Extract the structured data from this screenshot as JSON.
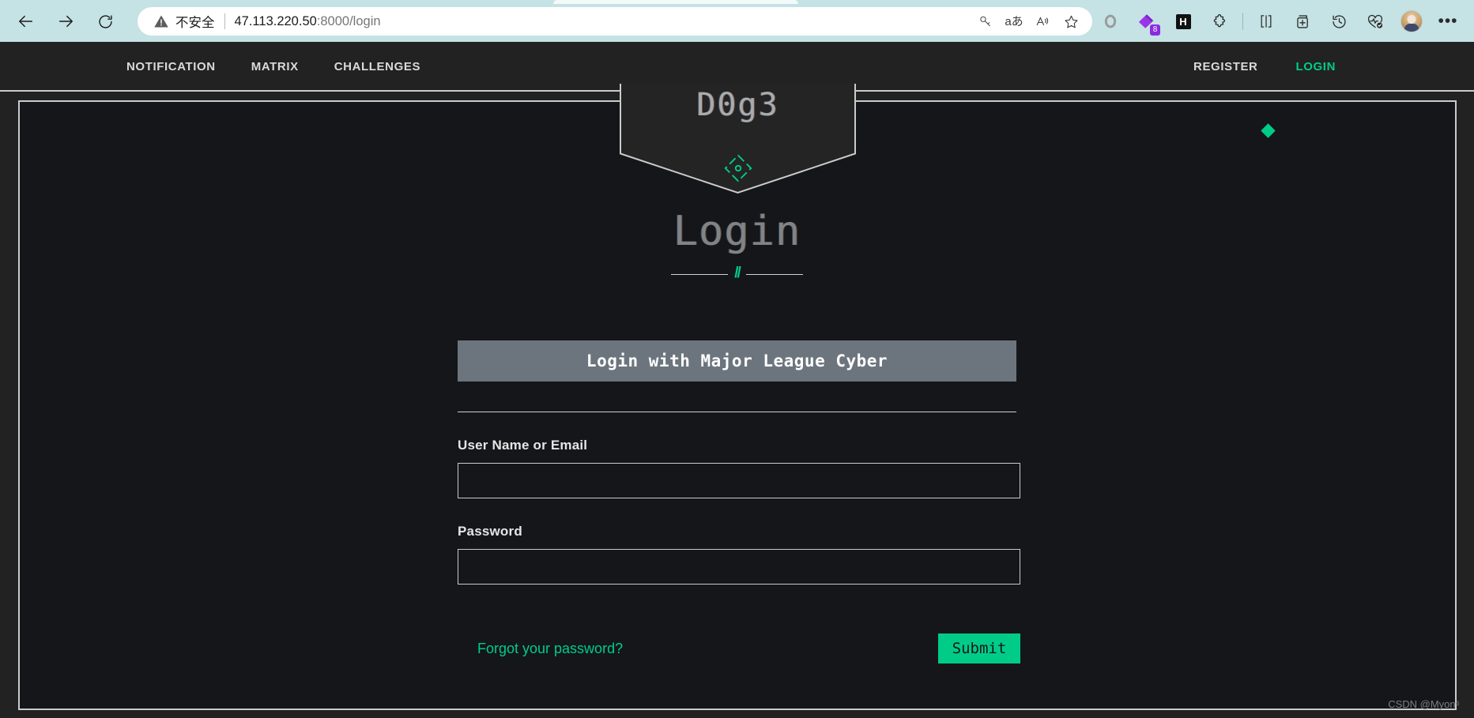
{
  "browser": {
    "back_label": "back",
    "forward_label": "forward",
    "reload_label": "reload",
    "security_text": "不安全",
    "url_host": "47.113.220.50",
    "url_rest": ":8000/login",
    "addr_icons": [
      {
        "name": "key-icon",
        "glyph": "⚷"
      },
      {
        "name": "translate-icon",
        "glyph": "aあ"
      },
      {
        "name": "read-aloud-icon",
        "glyph": "A"
      },
      {
        "name": "favorite-star-icon",
        "glyph": "☆"
      }
    ],
    "toolbar_icons": [
      {
        "name": "circle-icon",
        "label": ""
      },
      {
        "name": "extension-diamond-icon",
        "label": ""
      },
      {
        "name": "h-app-icon",
        "label": "H"
      },
      {
        "name": "extensions-puzzle-icon",
        "label": ""
      },
      {
        "name": "split-screen-icon",
        "label": ""
      },
      {
        "name": "collections-icon",
        "label": ""
      },
      {
        "name": "history-icon",
        "label": ""
      },
      {
        "name": "browser-essentials-icon",
        "label": ""
      }
    ],
    "extension_badge_count": "8",
    "ellipsis_label": "•••"
  },
  "site": {
    "logo": "D0g3",
    "nav_left": [
      {
        "label": "NOTIFICATION",
        "name": "nav-notification",
        "active": false
      },
      {
        "label": "MATRIX",
        "name": "nav-matrix",
        "active": false
      },
      {
        "label": "CHALLENGES",
        "name": "nav-challenges",
        "active": false
      }
    ],
    "nav_right": [
      {
        "label": "REGISTER",
        "name": "nav-register",
        "active": false
      },
      {
        "label": "LOGIN",
        "name": "nav-login",
        "active": true
      }
    ],
    "title": "Login",
    "divider_slashes": "//"
  },
  "form": {
    "mlc_button_label": "Login with Major League Cyber",
    "username_label": "User Name or Email",
    "username_value": "",
    "username_placeholder": "",
    "password_label": "Password",
    "password_value": "",
    "password_placeholder": "",
    "forgot_label": "Forgot your password?",
    "submit_label": "Submit"
  },
  "watermark": "CSDN @Myon⁶",
  "colors": {
    "accent_green": "#00cc88",
    "page_bg": "#222222",
    "panel_bg": "#141619",
    "border_light": "#c9cbcc",
    "mlc_button_bg": "#6c757d",
    "browser_chrome": "#c5e2e4"
  }
}
